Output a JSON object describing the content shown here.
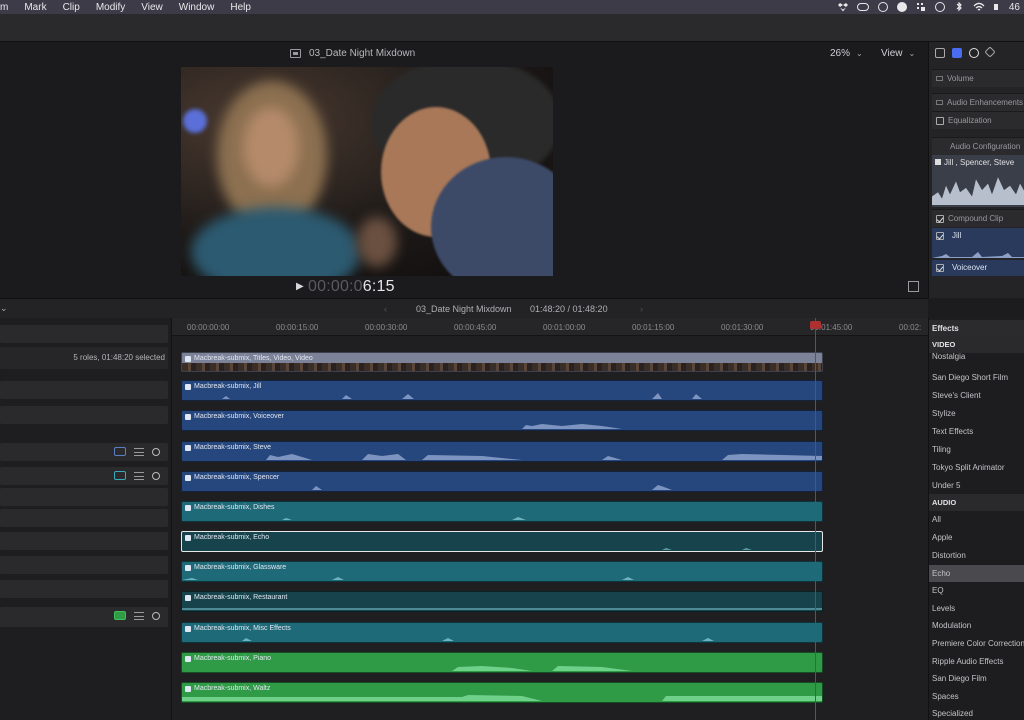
{
  "menubar": {
    "items": [
      "m",
      "Mark",
      "Clip",
      "Modify",
      "View",
      "Window",
      "Help"
    ],
    "battery": "46"
  },
  "viewer": {
    "title": "03_Date Night Mixdown",
    "zoom": "26%",
    "view_menu": "View",
    "timecode_dim": "00:00:0",
    "timecode": "6:15"
  },
  "inspector": {
    "volume": "Volume",
    "audio_enhancements": "Audio Enhancements",
    "equalization": "Equalization",
    "audio_configuration": "Audio Configuration",
    "role_label": "Jill , Spencer, Steve",
    "compound_clip": "Compound Clip",
    "jill": "Jill",
    "voiceover": "Voiceover"
  },
  "timeline": {
    "project": "03_Date Night Mixdown",
    "duration": "01:48:20 / 01:48:20",
    "roles_summary": "5 roles, 01:48:20 selected",
    "ruler": [
      "00:00:00:00",
      "00:00:15:00",
      "00:00:30:00",
      "00:00:45:00",
      "00:01:00:00",
      "00:01:15:00",
      "00:01:30:00",
      "00:01:45:00",
      "00:02:"
    ],
    "clips": [
      {
        "name": "Macbreak-submix, Titles, Video, Video",
        "kind": "compound"
      },
      {
        "name": "Macbreak-submix, Jill",
        "kind": "dialogue"
      },
      {
        "name": "Macbreak-submix, Voiceover",
        "kind": "dialogue"
      },
      {
        "name": "Macbreak-submix, Steve",
        "kind": "dialogue"
      },
      {
        "name": "Macbreak-submix, Spencer",
        "kind": "dialogue"
      },
      {
        "name": "Macbreak-submix, Dishes",
        "kind": "effects"
      },
      {
        "name": "Macbreak-submix, Echo",
        "kind": "effects-selected"
      },
      {
        "name": "Macbreak-submix, Glassware",
        "kind": "effects"
      },
      {
        "name": "Macbreak-submix, Restaurant",
        "kind": "effects-dark"
      },
      {
        "name": "Macbreak-submix, Misc Effects",
        "kind": "effects"
      },
      {
        "name": "Macbreak-submix, Piano",
        "kind": "music"
      },
      {
        "name": "Macbreak-submix, Waltz",
        "kind": "music"
      }
    ]
  },
  "effects_browser": {
    "title": "Effects",
    "items": [
      {
        "label": "VIDEO",
        "type": "category"
      },
      {
        "label": "Nostalgia",
        "type": "item"
      },
      {
        "label": "San Diego Short Film",
        "type": "item"
      },
      {
        "label": "Steve's Client",
        "type": "item"
      },
      {
        "label": "Stylize",
        "type": "item"
      },
      {
        "label": "Text Effects",
        "type": "item"
      },
      {
        "label": "Tiling",
        "type": "item"
      },
      {
        "label": "Tokyo Split Animator",
        "type": "item"
      },
      {
        "label": "Under 5",
        "type": "item"
      },
      {
        "label": "AUDIO",
        "type": "category"
      },
      {
        "label": "All",
        "type": "item"
      },
      {
        "label": "Apple",
        "type": "item"
      },
      {
        "label": "Distortion",
        "type": "item"
      },
      {
        "label": "Echo",
        "type": "selected"
      },
      {
        "label": "EQ",
        "type": "item"
      },
      {
        "label": "Levels",
        "type": "item"
      },
      {
        "label": "Modulation",
        "type": "item"
      },
      {
        "label": "Premiere Color Correction",
        "type": "item"
      },
      {
        "label": "Ripple Audio Effects",
        "type": "item"
      },
      {
        "label": "San Diego Film",
        "type": "item"
      },
      {
        "label": "Spaces",
        "type": "item"
      },
      {
        "label": "Specialized",
        "type": "item"
      }
    ]
  },
  "colors": {
    "dialogue": "#26477d",
    "effects": "#1f6a78",
    "effects_dark": "#16434c",
    "music": "#2f9b47",
    "playhead": "#b03030"
  }
}
